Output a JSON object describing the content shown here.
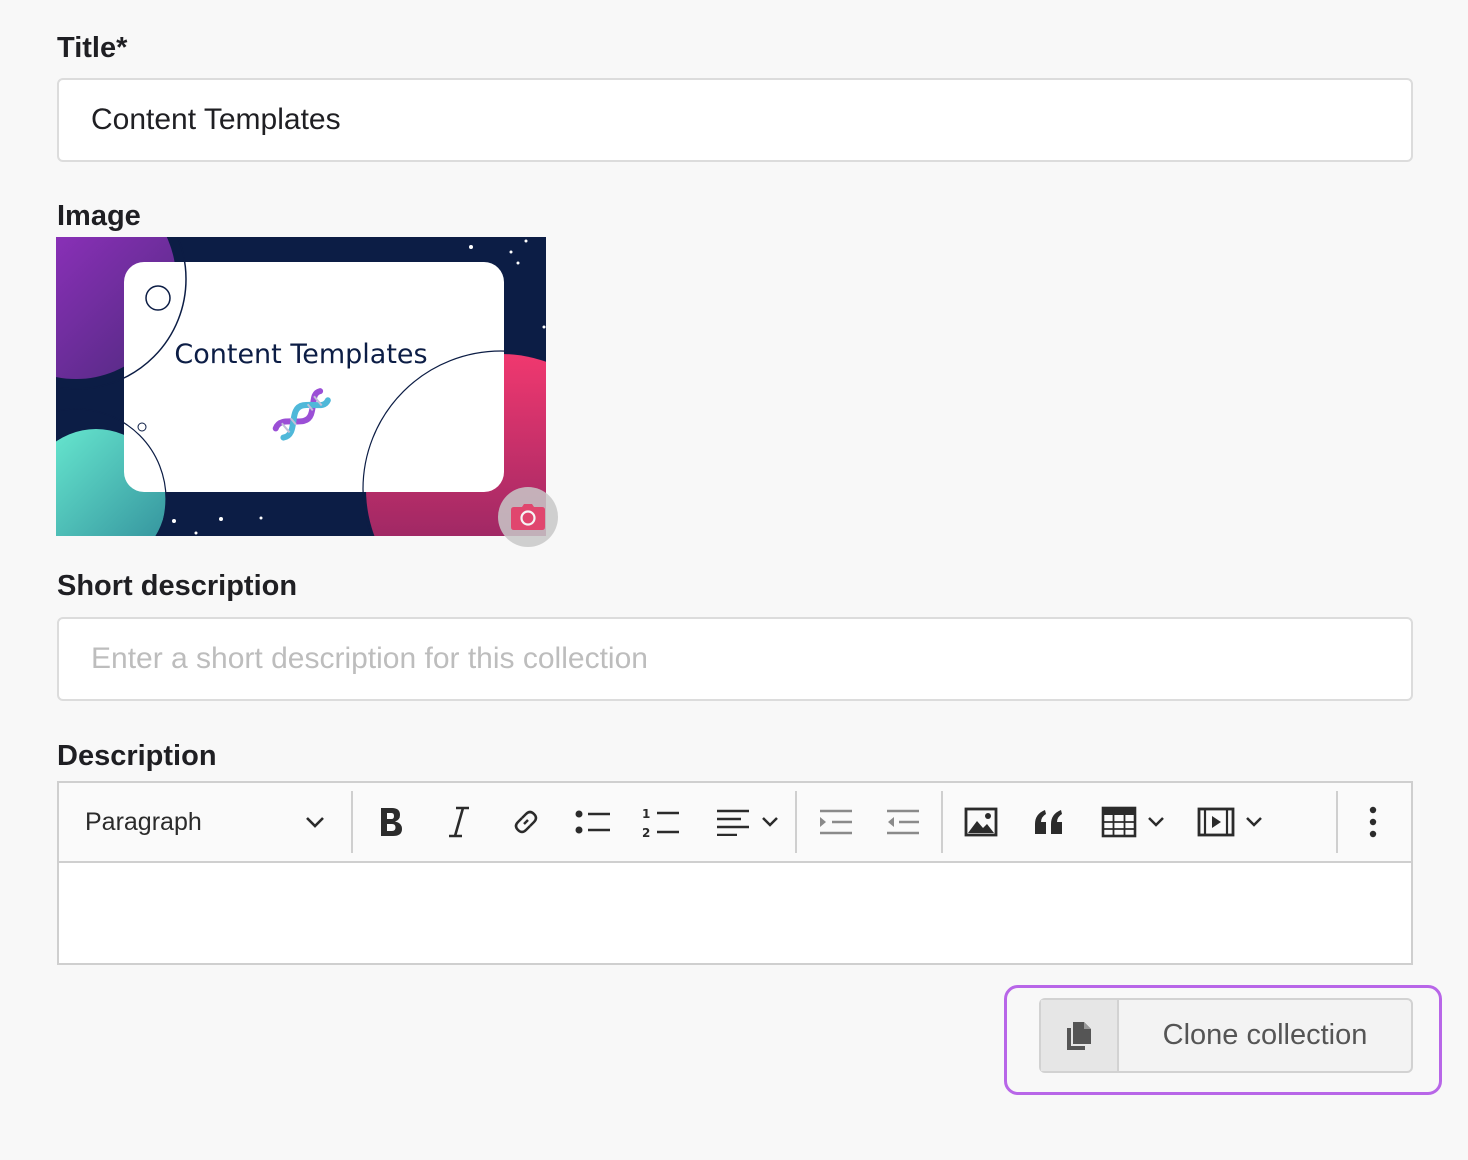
{
  "title_field": {
    "label": "Title*",
    "value": "Content Templates"
  },
  "image_field": {
    "label": "Image",
    "image_title": "Content Templates"
  },
  "short_description": {
    "label": "Short description",
    "value": "",
    "placeholder": "Enter a short description for this collection"
  },
  "description": {
    "label": "Description",
    "toolbar": {
      "block_format": "Paragraph",
      "tools": [
        "bold-icon",
        "italic-icon",
        "link-icon",
        "bulleted-list-icon",
        "numbered-list-icon",
        "align-icon",
        "indent-icon",
        "outdent-icon",
        "insert-image-icon",
        "block-quote-icon",
        "table-icon",
        "media-embed-icon",
        "more-options-icon"
      ]
    }
  },
  "clone_button": {
    "label": "Clone collection"
  },
  "colors": {
    "background": "#f8f8f8",
    "image_navy": "#0c1d45",
    "highlight_outline": "#b866e8",
    "camera_icon": "#e0466e"
  }
}
